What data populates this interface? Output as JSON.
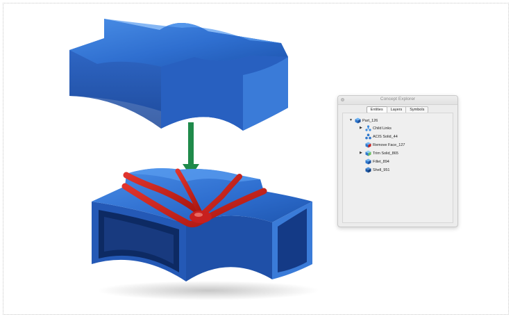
{
  "window": {
    "title": "Concept Explorer"
  },
  "tabs": [
    {
      "label": "Entities",
      "active": true
    },
    {
      "label": "Layers",
      "active": false
    },
    {
      "label": "Symbols",
      "active": false
    }
  ],
  "tree": [
    {
      "label": "Part_126",
      "icon": "part-icon",
      "expanded": true,
      "level": 0
    },
    {
      "label": "Child Links",
      "icon": "child-links-icon",
      "expanded": false,
      "level": 1
    },
    {
      "label": "ACIS Solid_44",
      "icon": "acis-solid-icon",
      "level": 1
    },
    {
      "label": "Remove Face_127",
      "icon": "remove-face-icon",
      "level": 1
    },
    {
      "label": "Trim Solid_865",
      "icon": "trim-solid-icon",
      "expanded": false,
      "level": 1
    },
    {
      "label": "Fillet_894",
      "icon": "fillet-icon",
      "level": 1
    },
    {
      "label": "Shell_951",
      "icon": "shell-icon",
      "level": 1
    }
  ],
  "colors": {
    "model_blue": "#2f6fd0",
    "model_dark": "#1b3f86",
    "highlight_red": "#c8201e",
    "arrow_green": "#1f8a4a"
  }
}
